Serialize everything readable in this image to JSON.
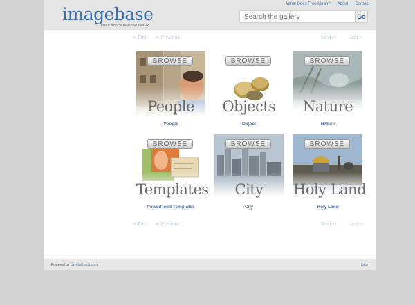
{
  "header": {
    "logo_text": "imagebase",
    "logo_tagline": "FREE STOCK PHOTOGRAPHY",
    "links": [
      "What Does Free Mean?",
      "About",
      "Contact"
    ],
    "search_placeholder": "Search the gallery",
    "search_button": "Go"
  },
  "pager": {
    "first": "First",
    "previous": "Previous",
    "next": "Next",
    "last": "Last"
  },
  "browse_label": "BROWSE",
  "tiles": [
    {
      "word": "People",
      "caption": "People"
    },
    {
      "word": "Objects",
      "caption": "Object"
    },
    {
      "word": "Nature",
      "caption": "Nature"
    },
    {
      "word": "Templates",
      "caption": "PowerPoint Templates"
    },
    {
      "word": "City",
      "caption": "City"
    },
    {
      "word": "Holy Land",
      "caption": "Holy Land"
    }
  ],
  "footer": {
    "powered_by": "Powered by",
    "powered_link": "davidnbbach.com",
    "login": "Login"
  }
}
